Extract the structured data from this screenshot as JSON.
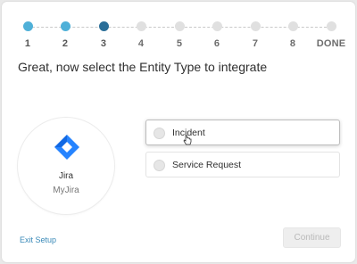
{
  "stepper": {
    "steps": [
      {
        "label": "1",
        "state": "done"
      },
      {
        "label": "2",
        "state": "done"
      },
      {
        "label": "3",
        "state": "current"
      },
      {
        "label": "4",
        "state": "todo"
      },
      {
        "label": "5",
        "state": "todo"
      },
      {
        "label": "6",
        "state": "todo"
      },
      {
        "label": "7",
        "state": "todo"
      },
      {
        "label": "8",
        "state": "todo"
      },
      {
        "label": "DONE",
        "state": "todo"
      }
    ]
  },
  "main": {
    "title": "Great, now select the Entity Type to integrate",
    "integration": {
      "name": "Jira",
      "instance": "MyJira",
      "icon": "jira-logo"
    },
    "options": [
      {
        "label": "Incident",
        "hovered": true
      },
      {
        "label": "Service Request",
        "hovered": false
      }
    ]
  },
  "footer": {
    "exit_label": "Exit Setup",
    "continue_label": "Continue"
  },
  "colors": {
    "done_step": "#4fb0d8",
    "current_step": "#2a6e98",
    "link": "#3a8ab8",
    "jira_blue": "#2684ff"
  }
}
